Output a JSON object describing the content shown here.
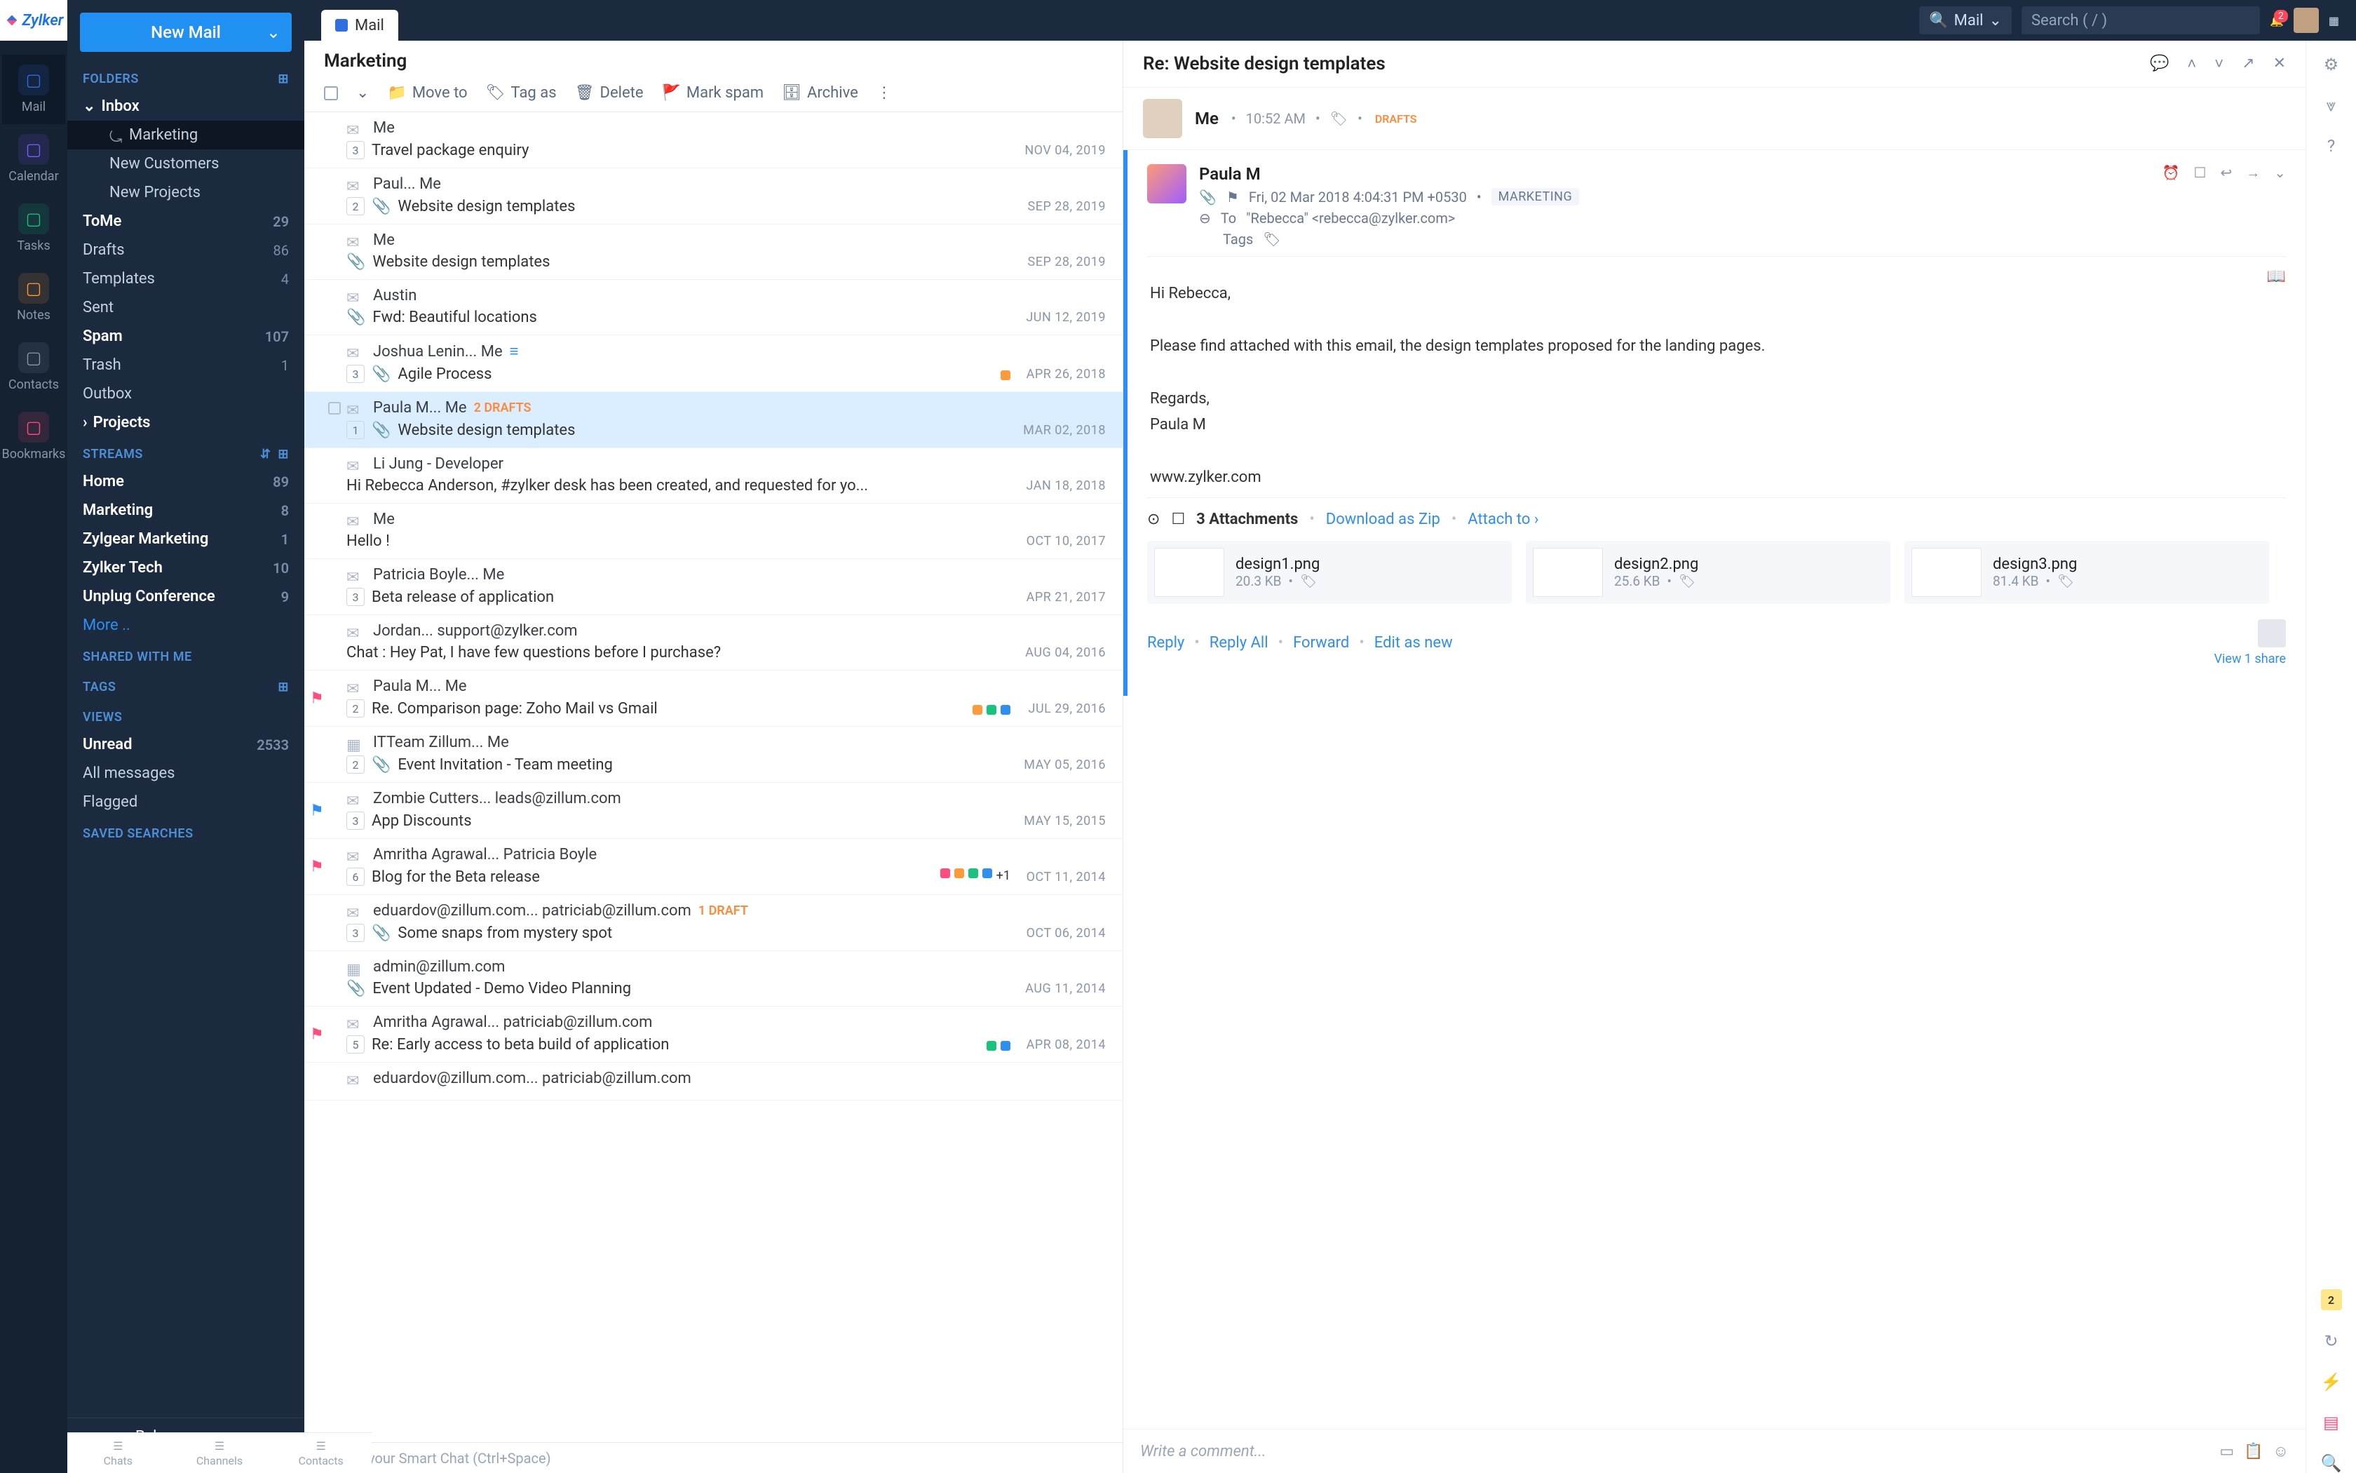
{
  "brand": "Zylker",
  "leftrail": [
    {
      "label": "Mail",
      "color": "#2f6fe0",
      "active": true
    },
    {
      "label": "Calendar",
      "color": "#7a5cff"
    },
    {
      "label": "Tasks",
      "color": "#19c37d"
    },
    {
      "label": "Notes",
      "color": "#ff9a3c"
    },
    {
      "label": "Contacts",
      "color": "#8a96aa"
    },
    {
      "label": "Bookmarks",
      "color": "#ff4d7e"
    }
  ],
  "sidebar": {
    "newMail": "New Mail",
    "sections": {
      "folders": "FOLDERS",
      "streams": "STREAMS",
      "shared": "SHARED WITH ME",
      "tags": "TAGS",
      "views": "VIEWS",
      "saved": "SAVED SEARCHES"
    },
    "folders": [
      {
        "label": "Inbox",
        "bold": true,
        "chevron": true
      },
      {
        "label": "Marketing",
        "sub": true,
        "selected": true,
        "share": true
      },
      {
        "label": "New Customers",
        "sub": true
      },
      {
        "label": "New Projects",
        "sub": true
      },
      {
        "label": "ToMe",
        "bold": true,
        "count": "29"
      },
      {
        "label": "Drafts",
        "count": "86"
      },
      {
        "label": "Templates",
        "count": "4"
      },
      {
        "label": "Sent"
      },
      {
        "label": "Spam",
        "bold": true,
        "count": "107"
      },
      {
        "label": "Trash",
        "count": "1"
      },
      {
        "label": "Outbox"
      },
      {
        "label": "Projects",
        "bold": true,
        "chevron": "right"
      }
    ],
    "streams": [
      {
        "label": "Home",
        "bold": true,
        "count": "89"
      },
      {
        "label": "Marketing",
        "bold": true,
        "count": "8"
      },
      {
        "label": "Zylgear Marketing",
        "bold": true,
        "count": "1"
      },
      {
        "label": "Zylker Tech",
        "bold": true,
        "count": "10"
      },
      {
        "label": "Unplug Conference",
        "bold": true,
        "count": "9"
      },
      {
        "label": "More ..",
        "link": true
      }
    ],
    "views": [
      {
        "label": "Unread",
        "bold": true,
        "count": "2533"
      },
      {
        "label": "All messages"
      },
      {
        "label": "Flagged"
      }
    ],
    "user": "Rebecca Anderson"
  },
  "topbar": {
    "tab": "Mail",
    "scope": "Mail",
    "searchPlaceholder": "Search ( / )",
    "bellCount": "2"
  },
  "list": {
    "title": "Marketing",
    "toolbar": {
      "moveto": "Move to",
      "tagas": "Tag as",
      "delete": "Delete",
      "markspam": "Mark spam",
      "archive": "Archive"
    },
    "rows": [
      {
        "from": "Me",
        "count": "3",
        "subj": "Travel package enquiry",
        "date": "NOV 04, 2019"
      },
      {
        "from": "Paul... Me",
        "count": "2",
        "clip": true,
        "subj": "Website design templates",
        "date": "SEP 28, 2019"
      },
      {
        "from": "Me",
        "clip": true,
        "subj": "Website design templates",
        "date": "SEP 28, 2019"
      },
      {
        "from": "Austin",
        "clip": true,
        "subj": "Fwd: Beautiful locations",
        "date": "JUN 12, 2019"
      },
      {
        "from": "Joshua Lenin... Me",
        "listIc": true,
        "count": "3",
        "clip": true,
        "subj": "Agile Process",
        "date": "APR 26, 2018",
        "tags": [
          "#ff9a3c"
        ]
      },
      {
        "from": "Paula M... Me",
        "drafts": "2 DRAFTS",
        "count": "1",
        "clip": true,
        "subj": "Website design templates",
        "date": "MAR 02, 2018",
        "selected": true,
        "checkbox": true
      },
      {
        "from": "Li Jung - Developer",
        "snippet": "Hi Rebecca Anderson, #zylker desk has been created, and requested for yo...",
        "date": "JAN 18, 2018"
      },
      {
        "from": "Me",
        "snippet": "Hello !",
        "date": "OCT 10, 2017"
      },
      {
        "from": "Patricia Boyle... Me",
        "count": "3",
        "subj": "Beta release of application",
        "date": "APR 21, 2017"
      },
      {
        "from": "Jordan... support@zylker.com",
        "snippet": "Chat : Hey Pat, I have few questions before I purchase?",
        "date": "AUG 04, 2016",
        "notch": true
      },
      {
        "from": "Paula M... Me",
        "flag": "#ff4d7e",
        "count": "2",
        "subj": "Re. Comparison page: Zoho Mail vs Gmail",
        "date": "JUL 29, 2016",
        "tags": [
          "#ff9a3c",
          "#19c37d",
          "#2f8ff0"
        ]
      },
      {
        "from": "ITTeam Zillum... Me",
        "count": "2",
        "clip": true,
        "subj": "Event Invitation - Team meeting",
        "date": "MAY 05, 2016",
        "calIc": true
      },
      {
        "from": "Zombie Cutters... leads@zillum.com",
        "flag": "#2f8ff0",
        "count": "3",
        "subj": "App Discounts",
        "date": "MAY 15, 2015",
        "notch": true
      },
      {
        "from": "Amritha Agrawal... Patricia Boyle",
        "flag": "#ff4d7e",
        "count": "6",
        "subj": "Blog for the Beta release",
        "date": "OCT 11, 2014",
        "tags": [
          "#ff4d7e",
          "#ff9a3c",
          "#19c37d",
          "#2f8ff0"
        ],
        "plus": "+1"
      },
      {
        "from": "eduardov@zillum.com... patriciab@zillum.com",
        "drafts": "1 DRAFT",
        "count": "3",
        "clip": true,
        "subj": "Some snaps from mystery spot",
        "date": "OCT 06, 2014"
      },
      {
        "from": "admin@zillum.com",
        "clip": true,
        "subj": "Event Updated - Demo Video Planning",
        "date": "AUG 11, 2014",
        "calIc": true
      },
      {
        "from": "Amritha Agrawal... patriciab@zillum.com",
        "flag": "#ff4d7e",
        "flag2": "#2f8ff0",
        "count": "5",
        "subj": "Re: Early access to beta build of application",
        "date": "APR 08, 2014",
        "tags": [
          "#19c37d",
          "#2f8ff0"
        ]
      },
      {
        "from": "eduardov@zillum.com... patriciab@zillum.com",
        "partial": true
      }
    ],
    "smartChat": "Here is your Smart Chat (Ctrl+Space)"
  },
  "reader": {
    "subject": "Re: Website design templates",
    "draft": {
      "from": "Me",
      "time": "10:52 AM",
      "tag": "DRAFTS"
    },
    "msg": {
      "from": "Paula M",
      "date": "Fri, 02 Mar 2018 4:04:31 PM +0530",
      "label": "MARKETING",
      "toLabel": "To",
      "to": "\"Rebecca\" <rebecca@zylker.com>",
      "tagsLabel": "Tags",
      "body": {
        "greeting": "Hi Rebecca,",
        "p1": "Please find attached with this email, the design templates proposed for the landing pages.",
        "regards": "Regards,",
        "sig": "Paula M",
        "url": "www.zylker.com"
      },
      "attHeader": "3 Attachments",
      "downloadZip": "Download as Zip",
      "attachTo": "Attach to",
      "attachments": [
        {
          "name": "design1.png",
          "size": "20.3 KB"
        },
        {
          "name": "design2.png",
          "size": "25.6 KB"
        },
        {
          "name": "design3.png",
          "size": "81.4 KB"
        }
      ],
      "actions": {
        "reply": "Reply",
        "replyall": "Reply All",
        "forward": "Forward",
        "editnew": "Edit as new"
      },
      "share": "View 1 share"
    },
    "commentPlaceholder": "Write a comment..."
  },
  "bottomrail": [
    {
      "label": "Chats"
    },
    {
      "label": "Channels"
    },
    {
      "label": "Contacts"
    }
  ],
  "rightrail": {
    "badge": "2"
  }
}
